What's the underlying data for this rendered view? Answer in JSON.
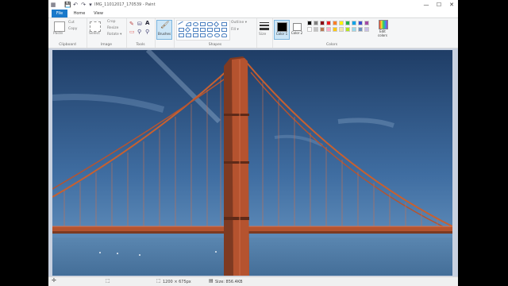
{
  "window": {
    "title": "IMG_11012017_170539 - Paint",
    "controls": {
      "minimize": "—",
      "maximize": "☐",
      "close": "✕"
    }
  },
  "quick_access": {
    "save_icon": "save-icon",
    "undo_icon": "undo-icon",
    "redo_icon": "redo-icon"
  },
  "tabs": [
    {
      "label": "File"
    },
    {
      "label": "Home"
    },
    {
      "label": "View"
    }
  ],
  "ribbon": {
    "clipboard": {
      "paste": "Paste",
      "cut": "Cut",
      "copy": "Copy",
      "group_label": "Clipboard"
    },
    "image": {
      "select": "Select",
      "crop": "Crop",
      "resize": "Resize",
      "rotate": "Rotate ▾",
      "group_label": "Image"
    },
    "tools": {
      "group_label": "Tools",
      "text_tool": "A"
    },
    "brushes": {
      "label": "Brushes"
    },
    "shapes": {
      "outline": "Outline ▾",
      "fill": "Fill ▾",
      "group_label": "Shapes"
    },
    "size": {
      "label": "Size"
    },
    "colors": {
      "color1": "Color 1",
      "color2": "Color 2",
      "edit_colors": "Edit colors",
      "group_label": "Colors",
      "palette_row1": [
        "#000000",
        "#7f7f7f",
        "#880015",
        "#ed1c24",
        "#ff7f27",
        "#fff200",
        "#22b14c",
        "#00a2e8",
        "#3f48cc",
        "#a349a4"
      ],
      "palette_row2": [
        "#ffffff",
        "#c3c3c3",
        "#b97a57",
        "#ffaec9",
        "#ffc90e",
        "#efe4b0",
        "#b5e61d",
        "#99d9ea",
        "#7092be",
        "#c8bfe7"
      ]
    }
  },
  "status": {
    "dimensions": "1200 × 675px",
    "size": "Size: 856.4KB"
  },
  "colors": {
    "file_tab": "#1979ca",
    "sky_top": "#1f3d66",
    "tower": "#b5532f"
  }
}
